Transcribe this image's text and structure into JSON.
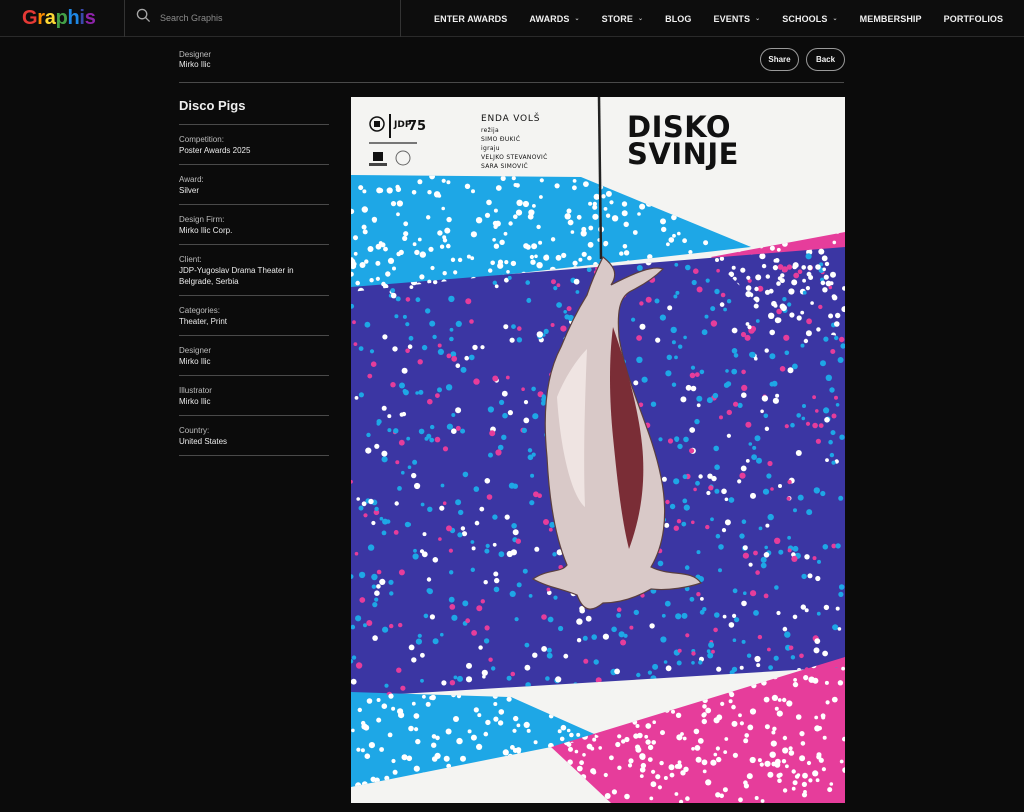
{
  "brand": {
    "logo_letters": [
      "G",
      "r",
      "a",
      "p",
      "h",
      "i",
      "s"
    ],
    "logo_colors": [
      "#e53935",
      "#fb8c00",
      "#fdd835",
      "#43a047",
      "#1e88e5",
      "#3949ab",
      "#8e24aa"
    ]
  },
  "search": {
    "placeholder": "Search Graphis",
    "icon": "search-icon"
  },
  "nav": [
    {
      "label": "ENTER AWARDS",
      "dropdown": false
    },
    {
      "label": "AWARDS",
      "dropdown": true
    },
    {
      "label": "STORE",
      "dropdown": true
    },
    {
      "label": "BLOG",
      "dropdown": false
    },
    {
      "label": "EVENTS",
      "dropdown": true
    },
    {
      "label": "SCHOOLS",
      "dropdown": true
    },
    {
      "label": "MEMBERSHIP",
      "dropdown": false
    },
    {
      "label": "PORTFOLIOS",
      "dropdown": false
    }
  ],
  "header": {
    "designer_label": "Designer",
    "designer_value": "Mirko Ilic",
    "share_label": "Share",
    "back_label": "Back"
  },
  "entry": {
    "title": "Disco Pigs",
    "fields": [
      {
        "label": "Competition:",
        "value": "Poster Awards 2025"
      },
      {
        "label": "Award:",
        "value": "Silver"
      },
      {
        "label": "Design Firm:",
        "value": "Mirko Ilic Corp."
      },
      {
        "label": "Client:",
        "value": "JDP-Yugoslav Drama Theater in Belgrade, Serbia"
      },
      {
        "label": "Categories:",
        "value": "Theater, Print"
      },
      {
        "label": "Designer",
        "value": "Mirko Ilic"
      },
      {
        "label": "Illustrator",
        "value": "Mirko Ilic"
      },
      {
        "label": "Country:",
        "value": "United States"
      }
    ]
  },
  "poster": {
    "title_line1": "DISKO",
    "title_line2": "SVINJE",
    "author": "ENDA VOLŠ",
    "credits": [
      "režija",
      "SIMO ĐUKIĆ",
      "igraju",
      "VELJKO STEVANOVIĆ",
      "SARA SIMOVIĆ"
    ],
    "logo_text": "JDP",
    "logo_number": "75",
    "colors": {
      "blue": "#3b36a3",
      "cyan": "#1ea7e6",
      "magenta": "#e63d9b",
      "paper": "#f4f4f2"
    }
  }
}
